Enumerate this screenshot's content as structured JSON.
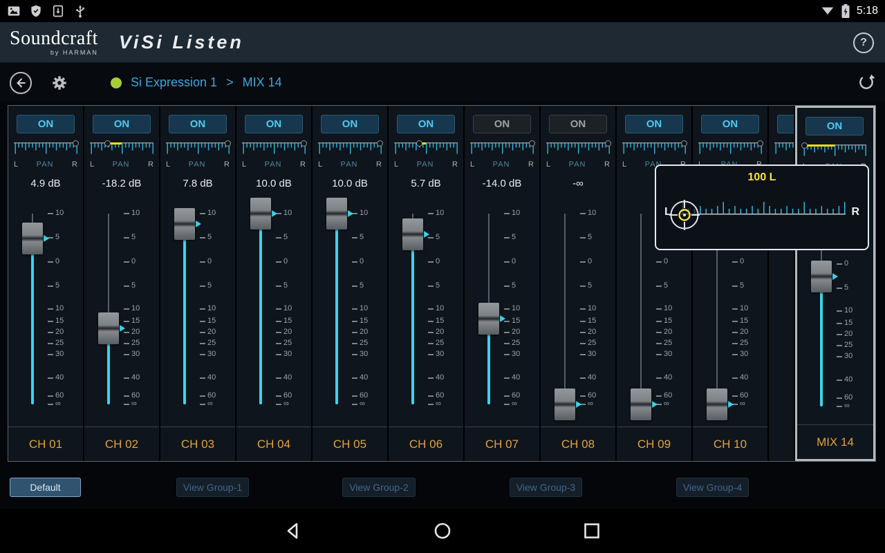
{
  "status_bar": {
    "time": "5:18",
    "left_icons": [
      "gallery",
      "shield",
      "screenshot",
      "usb-device"
    ],
    "right_icons": [
      "wifi",
      "battery-charging"
    ]
  },
  "header": {
    "brand": "Soundcraft",
    "brand_sub": "by HARMAN",
    "app_title": "ViSi Listen",
    "help": "?"
  },
  "breadcrumb": {
    "device": "Si Expression 1",
    "separator": ">",
    "target": "MIX 14"
  },
  "mixer": {
    "on_label": "ON",
    "pan_labels": {
      "left": "L",
      "center": "PAN",
      "right": "R"
    },
    "scale_marks": [
      {
        "label": "10",
        "db": 10
      },
      {
        "label": "5",
        "db": 5
      },
      {
        "label": "0",
        "db": 0
      },
      {
        "label": "5",
        "db": -5
      },
      {
        "label": "10",
        "db": -10
      },
      {
        "label": "15",
        "db": -15
      },
      {
        "label": "20",
        "db": -20
      },
      {
        "label": "25",
        "db": -25
      },
      {
        "label": "30",
        "db": -30
      },
      {
        "label": "40",
        "db": -40
      },
      {
        "label": "60",
        "db": -60
      },
      {
        "label": "∞",
        "db": "-inf"
      }
    ],
    "channels": [
      {
        "name": "CH 01",
        "on": true,
        "db_label": "4.9 dB",
        "db": 4.9,
        "pan": 97,
        "pan_highlight": false
      },
      {
        "name": "CH 02",
        "on": true,
        "db_label": "-18.2 dB",
        "db": -18.2,
        "pan": 28,
        "pan_highlight": true
      },
      {
        "name": "CH 03",
        "on": true,
        "db_label": "7.8 dB",
        "db": 7.8,
        "pan": 97,
        "pan_highlight": false
      },
      {
        "name": "CH 04",
        "on": true,
        "db_label": "10.0 dB",
        "db": 10.0,
        "pan": 97,
        "pan_highlight": false
      },
      {
        "name": "CH 05",
        "on": true,
        "db_label": "10.0 dB",
        "db": 10.0,
        "pan": 97,
        "pan_highlight": false
      },
      {
        "name": "CH 06",
        "on": true,
        "db_label": "5.7 dB",
        "db": 5.7,
        "pan": 40,
        "pan_highlight": true
      },
      {
        "name": "CH 07",
        "on": false,
        "db_label": "-14.0 dB",
        "db": -14.0,
        "pan": 97,
        "pan_highlight": false
      },
      {
        "name": "CH 08",
        "on": false,
        "db_label": "-∞",
        "db": "-inf",
        "pan": 97,
        "pan_highlight": false
      },
      {
        "name": "CH 09",
        "on": true,
        "db_label": "",
        "db": "-inf",
        "pan": 97,
        "pan_highlight": false
      },
      {
        "name": "CH 10",
        "on": true,
        "db_label": "",
        "db": "-inf",
        "pan": 97,
        "pan_highlight": false
      }
    ],
    "overflow_channel": {
      "on_label": "ON"
    },
    "master": {
      "name": "MIX 14",
      "on": true,
      "db_label": "",
      "db": -2.5,
      "pan": 3,
      "pan_highlight": true
    }
  },
  "pan_popup": {
    "value": "100 L",
    "left": "L",
    "right": "R"
  },
  "footer": {
    "buttons": [
      {
        "label": "Default",
        "active": true
      },
      {
        "label": "View Group-1",
        "active": false
      },
      {
        "label": "View Group-2",
        "active": false
      },
      {
        "label": "View Group-3",
        "active": false
      },
      {
        "label": "View Group-4",
        "active": false
      }
    ]
  },
  "colors": {
    "accent_cyan": "#3ed3ea",
    "pan_yellow": "#ffdf00",
    "channel_orange": "#e2a23f",
    "breadcrumb_blue": "#3ea6e0",
    "online_green": "#a6ce39"
  }
}
